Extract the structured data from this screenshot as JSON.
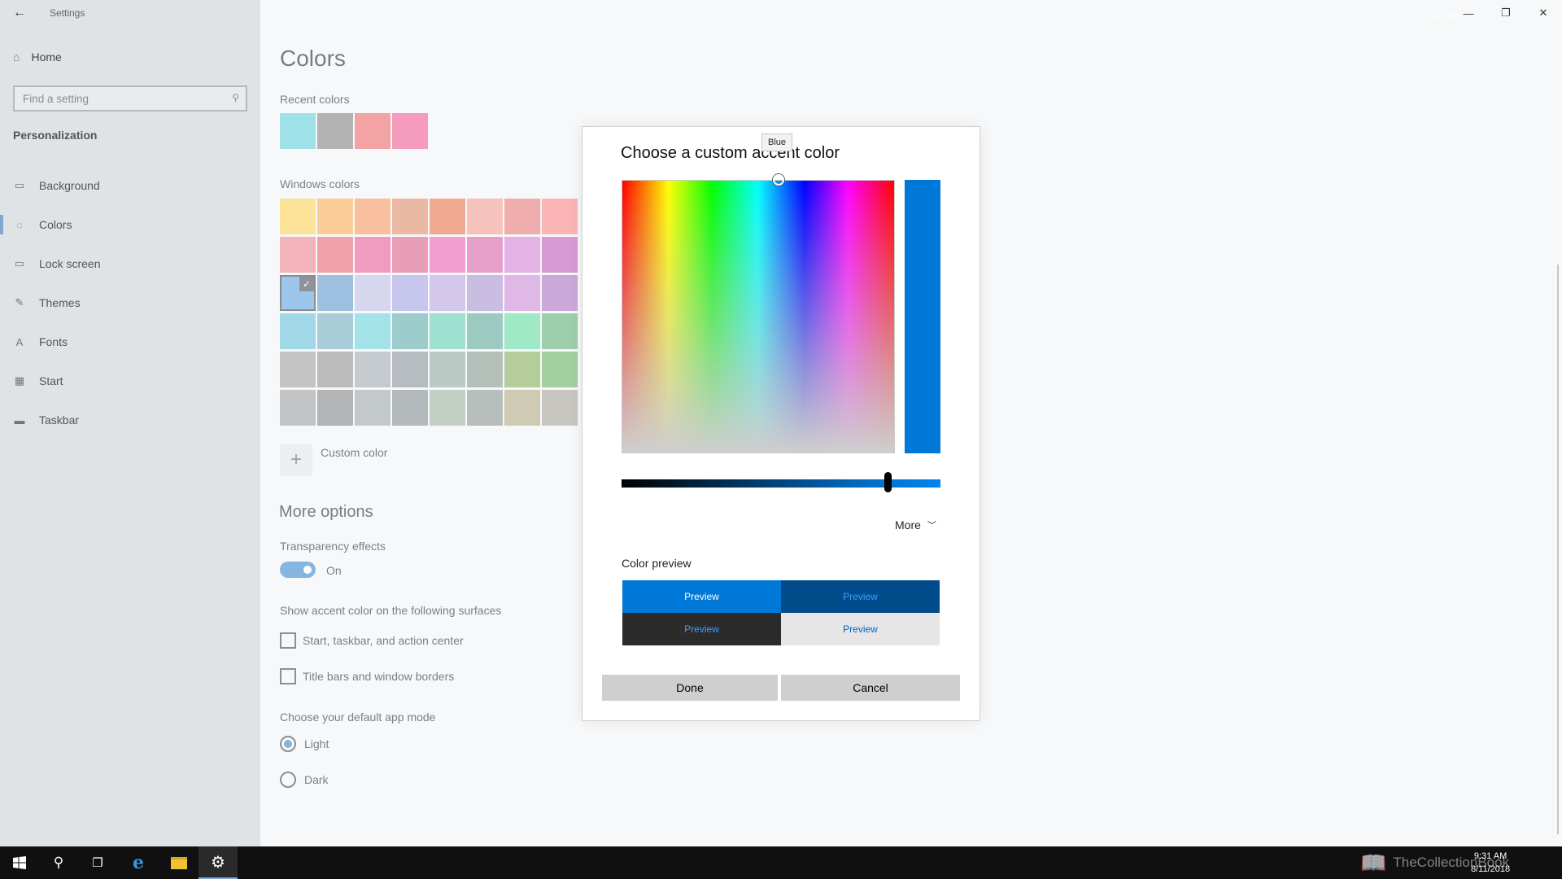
{
  "window": {
    "app_title": "Settings",
    "back_icon": "back-arrow-icon",
    "controls": [
      "minimize-icon",
      "restore-icon",
      "close-icon"
    ]
  },
  "sidebar": {
    "home_label": "Home",
    "search_placeholder": "Find a setting",
    "section": "Personalization",
    "items": [
      {
        "label": "Background",
        "icon": "image-icon"
      },
      {
        "label": "Colors",
        "icon": "palette-icon",
        "active": true
      },
      {
        "label": "Lock screen",
        "icon": "monitor-icon"
      },
      {
        "label": "Themes",
        "icon": "brush-icon"
      },
      {
        "label": "Fonts",
        "icon": "font-icon"
      },
      {
        "label": "Start",
        "icon": "start-grid-icon"
      },
      {
        "label": "Taskbar",
        "icon": "taskbar-icon"
      }
    ]
  },
  "main": {
    "title": "Colors",
    "recent_colors_label": "Recent colors",
    "recent_colors": [
      "#9fe1e8",
      "#b3b3b3",
      "#f4a3a4",
      "#f59bbd"
    ],
    "windows_colors_label": "Windows colors",
    "windows_colors": [
      [
        "#fde29a",
        "#fccc98",
        "#f9c0a0",
        "#e9b9a3",
        "#efaa90",
        "#f6c3bc",
        "#f0adad",
        "#fbb5b5"
      ],
      [
        "#f3b3ba",
        "#f1a2a8",
        "#f29bc0",
        "#e89eb7",
        "#f29ed2",
        "#e69fca",
        "#e4b2e4",
        "#d89ad2"
      ],
      [
        "#9cc6ec",
        "#9dc0e0",
        "#d6d6ee",
        "#c7c7ee",
        "#d3c7ea",
        "#c9bde1",
        "#e0b8e6",
        "#cba8da"
      ],
      [
        "#a1d8e8",
        "#a8cdd8",
        "#a3e3e8",
        "#9ccccc",
        "#9fe1d1",
        "#9cc9c0",
        "#9fe9c6",
        "#9ecfac"
      ],
      [
        "#c4c4c4",
        "#bbbbbb",
        "#c5cacf",
        "#b7bcc0",
        "#bccac6",
        "#b5c0bb",
        "#b5cc9b",
        "#a4cf9f"
      ],
      [
        "#c3c4c5",
        "#b3b4b5",
        "#c3c8ca",
        "#b4b9bc",
        "#c4cfc4",
        "#b8bebb",
        "#cfcab3",
        "#c8c6c0"
      ]
    ],
    "selected_swatch": "2-0",
    "custom_color_label": "Custom color",
    "more_options_heading": "More options",
    "transparency_label": "Transparency effects",
    "transparency_state": "On",
    "surfaces_label": "Show accent color on the following surfaces",
    "surface_start": "Start, taskbar, and action center",
    "surface_titlebars": "Title bars and window borders",
    "app_mode_label": "Choose your default app mode",
    "mode_light": "Light",
    "mode_dark": "Dark",
    "selected_mode": "Light"
  },
  "dialog": {
    "title": "Choose a custom accent color",
    "tooltip": "Blue",
    "current_color": "#0078d7",
    "more_label": "More",
    "preview_heading": "Color preview",
    "preview_text": "Preview",
    "done_label": "Done",
    "cancel_label": "Cancel"
  },
  "taskbar": {
    "icons": [
      "windows-start-icon",
      "search-icon",
      "task-view-icon",
      "edge-browser-icon",
      "file-explorer-icon",
      "settings-gear-icon"
    ],
    "time": "9:31 AM",
    "date": "8/11/2018",
    "watermark": "TheCollectionBook"
  }
}
